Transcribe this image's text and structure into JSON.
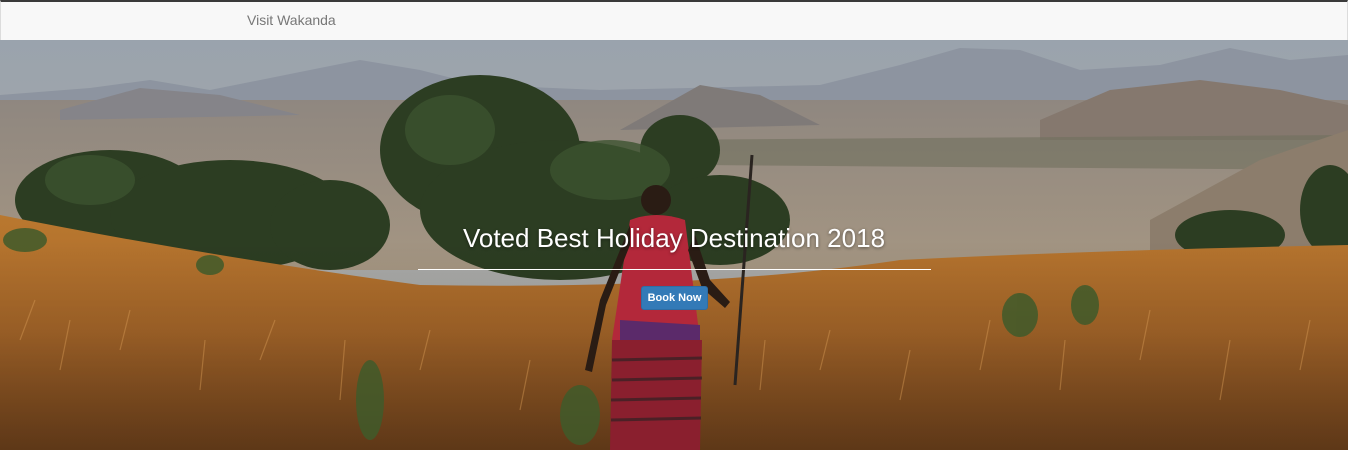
{
  "navbar": {
    "brand": "Visit Wakanda"
  },
  "hero": {
    "title": "Voted Best Holiday Destination 2018",
    "button_label": "Book Now",
    "image_subject": "savanna-landscape-with-person-walking"
  },
  "colors": {
    "button": "#337ab7",
    "navbar_bg": "#f8f8f8",
    "brand_text": "#777777"
  }
}
